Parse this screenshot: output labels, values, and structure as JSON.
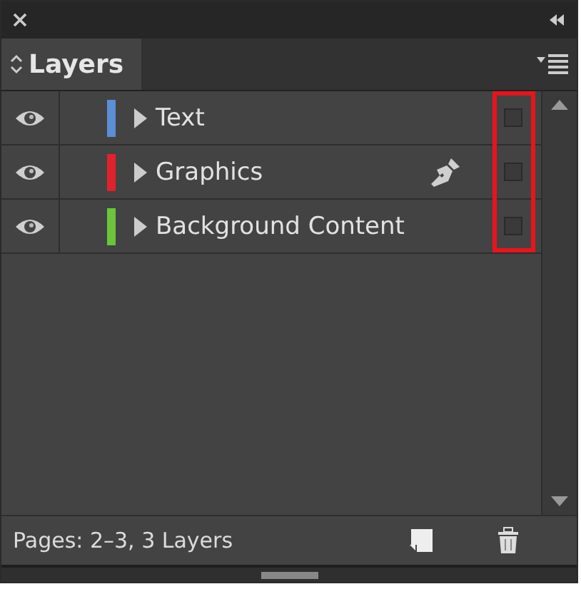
{
  "panel": {
    "title": "Layers"
  },
  "layers": [
    {
      "name": "Text",
      "color": "#5b8fd6",
      "visible": true,
      "expanded": false,
      "current": false,
      "locked": false
    },
    {
      "name": "Graphics",
      "color": "#e0222a",
      "visible": true,
      "expanded": false,
      "current": true,
      "locked": false
    },
    {
      "name": "Background Content",
      "color": "#6cc43a",
      "visible": true,
      "expanded": false,
      "current": false,
      "locked": false
    }
  ],
  "status_bar": {
    "text": "Pages: 2–3, 3 Layers"
  }
}
